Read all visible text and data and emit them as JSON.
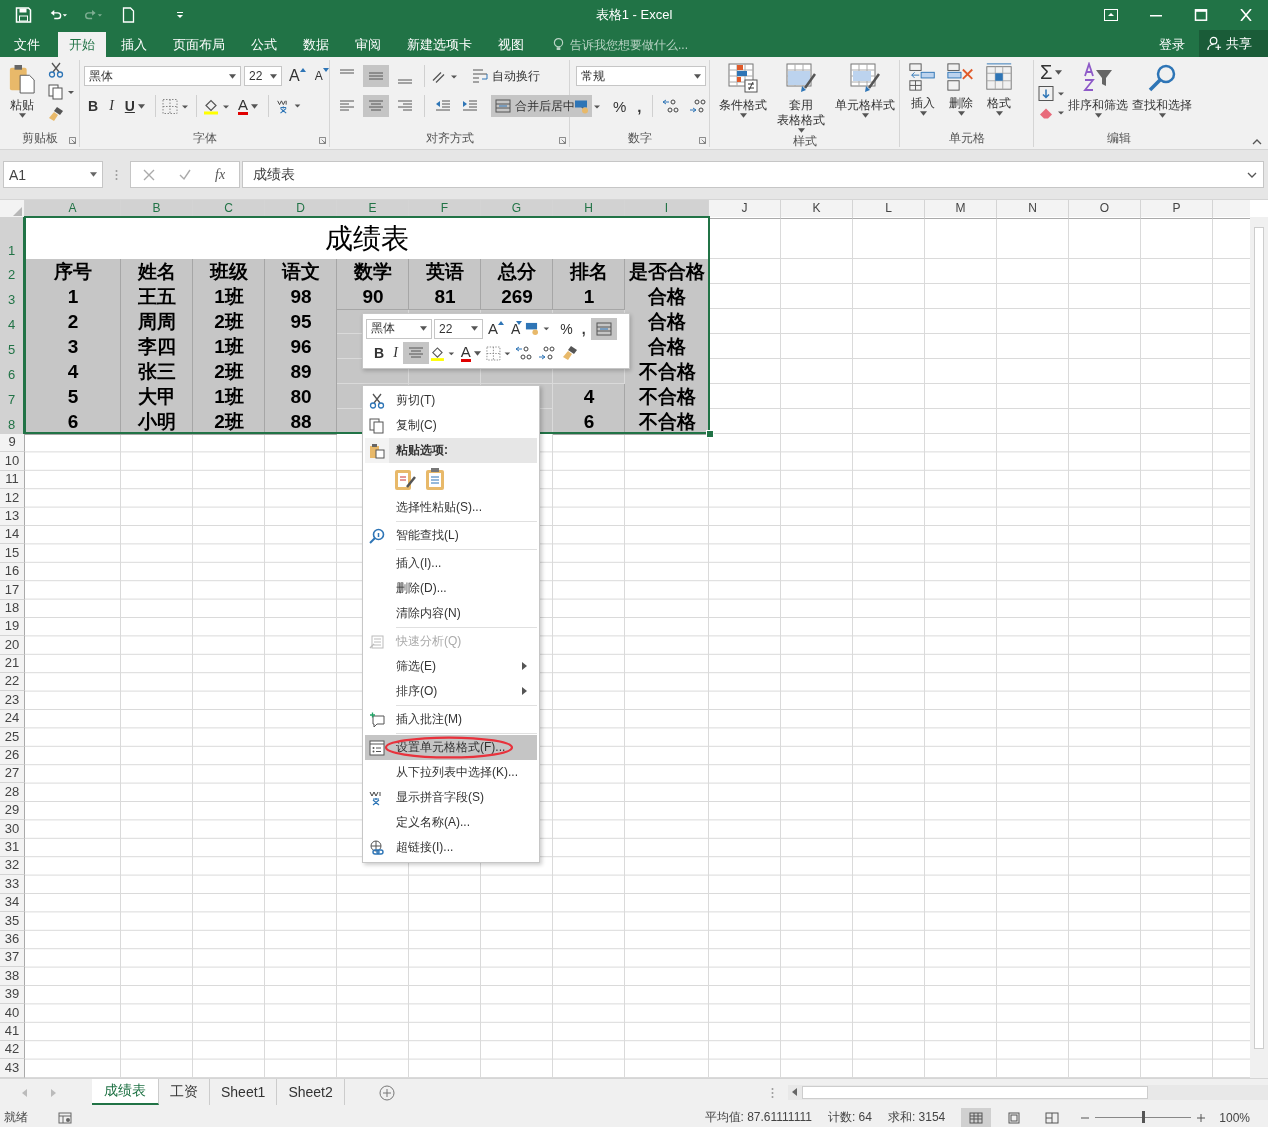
{
  "title_bar": {
    "title": "表格1 - Excel"
  },
  "tabs": [
    {
      "label": "文件",
      "selected": false
    },
    {
      "label": "开始",
      "selected": true
    },
    {
      "label": "插入",
      "selected": false
    },
    {
      "label": "页面布局",
      "selected": false
    },
    {
      "label": "公式",
      "selected": false
    },
    {
      "label": "数据",
      "selected": false
    },
    {
      "label": "审阅",
      "selected": false
    },
    {
      "label": "新建选项卡",
      "selected": false
    },
    {
      "label": "视图",
      "selected": false
    }
  ],
  "tell_me": {
    "placeholder": "告诉我您想要做什么..."
  },
  "account": {
    "sign_in": "登录",
    "share": "共享"
  },
  "ribbon": {
    "clipboard": {
      "label": "剪贴板",
      "paste": "粘贴"
    },
    "font": {
      "label": "字体",
      "font_name": "黑体",
      "font_size": "22",
      "grow": "A",
      "shrink": "A",
      "bold": "B",
      "italic": "I",
      "underline": "U",
      "font_color": "A"
    },
    "alignment": {
      "label": "对齐方式",
      "vertical": [
        {
          "kind": "top",
          "selected": false
        },
        {
          "kind": "middle",
          "selected": true
        },
        {
          "kind": "bottom",
          "selected": false
        }
      ],
      "horizontal": [
        {
          "kind": "left",
          "selected": false
        },
        {
          "kind": "center",
          "selected": true
        },
        {
          "kind": "right",
          "selected": false
        }
      ],
      "wrap_text": {
        "label": "自动换行",
        "selected": false
      },
      "merge_center": {
        "label": "合并后居中",
        "selected": true
      }
    },
    "number": {
      "label": "数字",
      "format": "常规",
      "percent": "%",
      "comma": ","
    },
    "styles": {
      "label": "样式",
      "buttons": [
        {
          "lines": [
            "条件格式"
          ],
          "kind": "conditional"
        },
        {
          "lines": [
            "套用",
            "表格格式"
          ],
          "kind": "table"
        },
        {
          "lines": [
            "单元格样式"
          ],
          "kind": "cell"
        }
      ]
    },
    "cells": {
      "label": "单元格",
      "buttons": [
        {
          "label": "插入",
          "kind": "insert"
        },
        {
          "label": "删除",
          "kind": "delete"
        },
        {
          "label": "格式",
          "kind": "format"
        }
      ]
    },
    "editing": {
      "label": "编辑",
      "sum": "Σ",
      "buttons": [
        {
          "label": "排序和筛选",
          "kind": "sort"
        },
        {
          "label": "查找和选择",
          "kind": "find"
        }
      ]
    }
  },
  "formula_bar": {
    "name_box": "A1",
    "fx": "fx",
    "value": "成绩表"
  },
  "sheet": {
    "columns": [
      {
        "label": "A",
        "selected": true
      },
      {
        "label": "B",
        "selected": true
      },
      {
        "label": "C",
        "selected": true
      },
      {
        "label": "D",
        "selected": true
      },
      {
        "label": "E",
        "selected": true
      },
      {
        "label": "F",
        "selected": true
      },
      {
        "label": "G",
        "selected": true
      },
      {
        "label": "H",
        "selected": true
      },
      {
        "label": "I",
        "selected": true
      },
      {
        "label": "J",
        "selected": false
      },
      {
        "label": "K",
        "selected": false
      },
      {
        "label": "L",
        "selected": false
      },
      {
        "label": "M",
        "selected": false
      },
      {
        "label": "N",
        "selected": false
      },
      {
        "label": "O",
        "selected": false
      },
      {
        "label": "P",
        "selected": false
      }
    ],
    "rows": [
      {
        "number": "1",
        "selected": true,
        "merged": "成绩表"
      },
      {
        "number": "2",
        "selected": true,
        "A": "序号",
        "B": "姓名",
        "C": "班级",
        "D": "语文",
        "E": "数学",
        "F": "英语",
        "G": "总分",
        "H": "排名",
        "I": "是否合格"
      },
      {
        "number": "3",
        "selected": true,
        "A": "1",
        "B": "王五",
        "C": "1班",
        "D": "98",
        "E": "90",
        "F": "81",
        "G": "269",
        "H": "1",
        "I": "合格"
      },
      {
        "number": "4",
        "selected": true,
        "A": "2",
        "B": "周周",
        "C": "2班",
        "D": "95",
        "I": "合格"
      },
      {
        "number": "5",
        "selected": true,
        "A": "3",
        "B": "李四",
        "C": "1班",
        "D": "96",
        "I": "合格"
      },
      {
        "number": "6",
        "selected": true,
        "A": "4",
        "B": "张三",
        "C": "2班",
        "D": "89",
        "I": "不合格"
      },
      {
        "number": "7",
        "selected": true,
        "A": "5",
        "B": "大甲",
        "C": "1班",
        "D": "80",
        "H": "4",
        "I": "不合格"
      },
      {
        "number": "8",
        "selected": true,
        "A": "6",
        "B": "小明",
        "C": "2班",
        "D": "88",
        "H": "6",
        "I": "不合格"
      }
    ],
    "empty_rows": [
      "9",
      "10",
      "11",
      "12",
      "13",
      "14",
      "15",
      "16",
      "17",
      "18",
      "19",
      "20",
      "21",
      "22",
      "23",
      "24",
      "25",
      "26",
      "27",
      "28",
      "29",
      "30",
      "31",
      "32",
      "33",
      "34",
      "35",
      "36",
      "37",
      "38",
      "39",
      "40",
      "41",
      "42",
      "43"
    ]
  },
  "mini_toolbar": {
    "font_name": "黑体",
    "font_size": "22",
    "grow": "A",
    "shrink": "A",
    "percent": "%",
    "comma": ",",
    "bold": "B",
    "italic": "I",
    "font_color": "A",
    "center_selected": true,
    "merge_selected": true
  },
  "context_menu": [
    {
      "kind": "cut",
      "label": "剪切(T)",
      "selected": false,
      "disabled": false,
      "submenu": false,
      "circled": false
    },
    {
      "kind": "copy",
      "label": "复制(C)",
      "selected": false,
      "disabled": false,
      "submenu": false,
      "circled": false
    },
    {
      "kind": "paste",
      "label": "粘贴选项:",
      "selected": false,
      "disabled": false,
      "submenu": false,
      "circled": false
    },
    {
      "kind": "paste_icons"
    },
    {
      "kind": "plain",
      "label": "选择性粘贴(S)...",
      "selected": false,
      "disabled": false,
      "submenu": false,
      "circled": false
    },
    {
      "kind": "separator"
    },
    {
      "kind": "lookup",
      "label": "智能查找(L)",
      "selected": false,
      "disabled": false,
      "submenu": false,
      "circled": false
    },
    {
      "kind": "separator"
    },
    {
      "kind": "plain",
      "label": "插入(I)...",
      "selected": false,
      "disabled": false,
      "submenu": false,
      "circled": false
    },
    {
      "kind": "plain",
      "label": "删除(D)...",
      "selected": false,
      "disabled": false,
      "submenu": false,
      "circled": false
    },
    {
      "kind": "plain",
      "label": "清除内容(N)",
      "selected": false,
      "disabled": false,
      "submenu": false,
      "circled": false
    },
    {
      "kind": "separator"
    },
    {
      "kind": "quick_analysis",
      "label": "快速分析(Q)",
      "selected": false,
      "disabled": true,
      "submenu": false,
      "circled": false
    },
    {
      "kind": "plain",
      "label": "筛选(E)",
      "selected": false,
      "disabled": false,
      "submenu": true,
      "circled": false
    },
    {
      "kind": "plain",
      "label": "排序(O)",
      "selected": false,
      "disabled": false,
      "submenu": true,
      "circled": false
    },
    {
      "kind": "separator"
    },
    {
      "kind": "comment",
      "label": "插入批注(M)",
      "selected": false,
      "disabled": false,
      "submenu": false,
      "circled": false
    },
    {
      "kind": "separator"
    },
    {
      "kind": "format_cells",
      "label": "设置单元格格式(F)...",
      "selected": true,
      "disabled": false,
      "submenu": false,
      "circled": true
    },
    {
      "kind": "plain",
      "label": "从下拉列表中选择(K)...",
      "selected": false,
      "disabled": false,
      "submenu": false,
      "circled": false
    },
    {
      "kind": "phonetic",
      "label": "显示拼音字段(S)",
      "selected": false,
      "disabled": false,
      "submenu": false,
      "circled": false
    },
    {
      "kind": "plain",
      "label": "定义名称(A)...",
      "selected": false,
      "disabled": false,
      "submenu": false,
      "circled": false
    },
    {
      "kind": "link",
      "label": "超链接(I)...",
      "selected": false,
      "disabled": false,
      "submenu": false,
      "circled": false
    }
  ],
  "sheet_tabs": [
    {
      "label": "成绩表",
      "selected": true
    },
    {
      "label": "工资",
      "selected": false
    },
    {
      "label": "Sheet1",
      "selected": false
    },
    {
      "label": "Sheet2",
      "selected": false
    }
  ],
  "status_bar": {
    "ready": "就绪",
    "average": "平均值: 87.61111111",
    "count": "计数: 64",
    "sum": "求和: 3154",
    "views": [
      {
        "kind": "normal",
        "selected": true
      },
      {
        "kind": "page_layout",
        "selected": false
      },
      {
        "kind": "page_break",
        "selected": false
      }
    ],
    "zoom": {
      "level": 0.5,
      "reading": "100%"
    }
  }
}
